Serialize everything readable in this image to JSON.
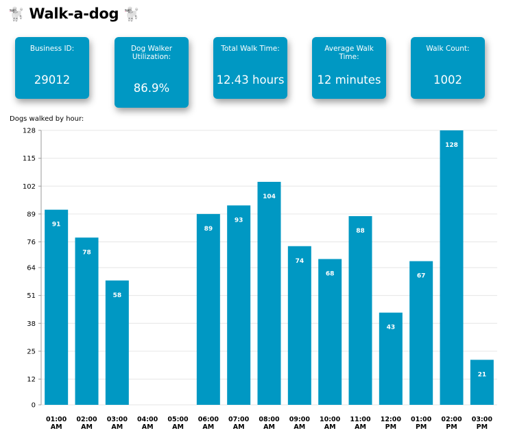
{
  "header": {
    "title": "Walk-a-dog",
    "emoji_left": "🐩",
    "emoji_right": "🐩"
  },
  "cards": [
    {
      "label": "Business ID:",
      "value": "29012"
    },
    {
      "label": "Dog Walker Utilization:",
      "value": "86.9%"
    },
    {
      "label": "Total Walk Time:",
      "value": "12.43 hours"
    },
    {
      "label": "Average Walk Time:",
      "value": "12 minutes"
    },
    {
      "label": "Walk Count:",
      "value": "1002"
    }
  ],
  "colors": {
    "accent": "#0098c3",
    "grid": "#e6e6e6",
    "axis": "#999999"
  },
  "chart_data": {
    "type": "bar",
    "title": "Dogs walked by hour:",
    "categories": [
      [
        "01:00",
        "AM"
      ],
      [
        "02:00",
        "AM"
      ],
      [
        "03:00",
        "AM"
      ],
      [
        "04:00",
        "AM"
      ],
      [
        "05:00",
        "AM"
      ],
      [
        "06:00",
        "AM"
      ],
      [
        "07:00",
        "AM"
      ],
      [
        "08:00",
        "AM"
      ],
      [
        "09:00",
        "AM"
      ],
      [
        "10:00",
        "AM"
      ],
      [
        "11:00",
        "AM"
      ],
      [
        "12:00",
        "PM"
      ],
      [
        "01:00",
        "PM"
      ],
      [
        "02:00",
        "PM"
      ],
      [
        "03:00",
        "PM"
      ]
    ],
    "values": [
      91,
      78,
      58,
      0,
      0,
      89,
      93,
      104,
      74,
      68,
      88,
      43,
      67,
      128,
      21
    ],
    "data_labels": [
      "91",
      "78",
      "58",
      "",
      "",
      "89",
      "93",
      "104",
      "74",
      "68",
      "88",
      "43",
      "67",
      "128",
      "21"
    ],
    "yticks": [
      0,
      12,
      25,
      38,
      51,
      64,
      76,
      89,
      102,
      115,
      128
    ],
    "ylim": [
      0,
      128
    ],
    "grid": true,
    "legend": "none"
  }
}
